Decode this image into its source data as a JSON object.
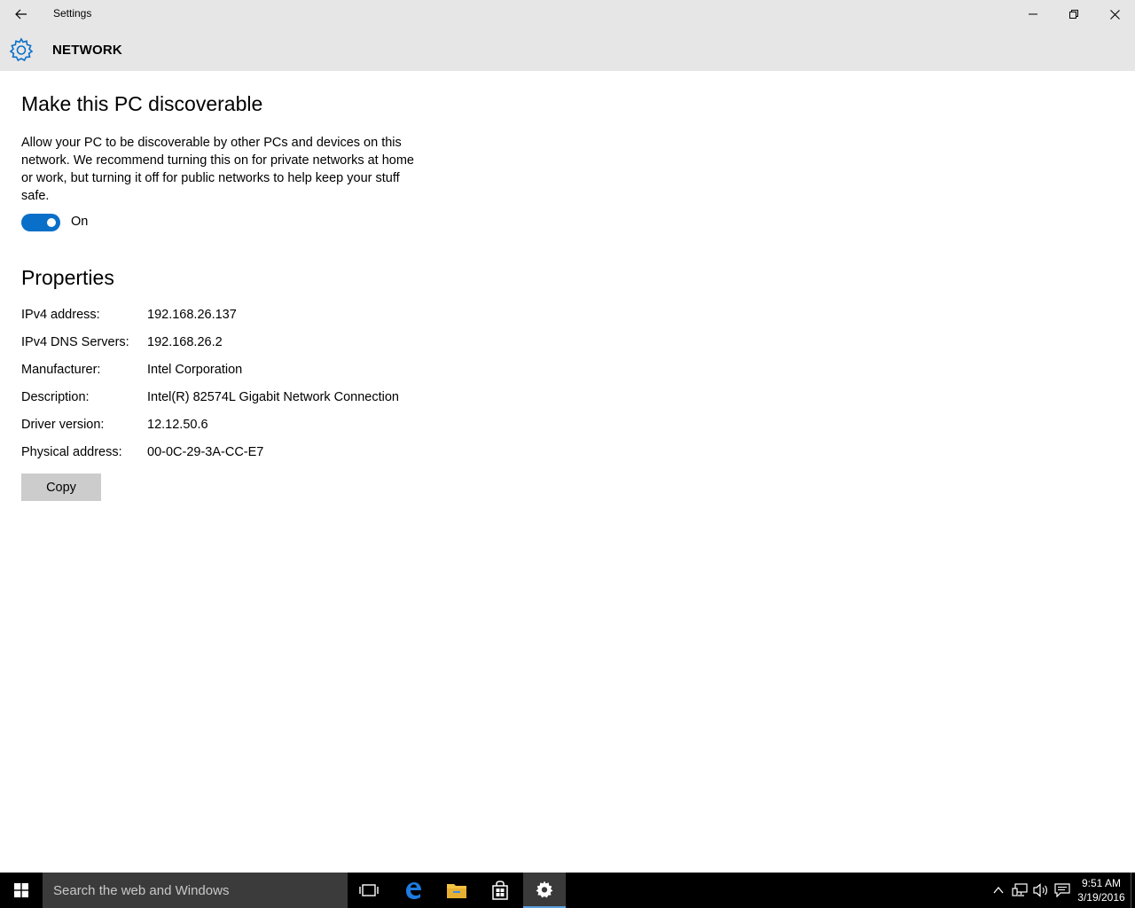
{
  "window": {
    "title": "Settings",
    "back_icon": "arrow-left-icon",
    "minimize_icon": "minimize-icon",
    "restore_icon": "restore-icon",
    "close_icon": "close-icon"
  },
  "header": {
    "icon": "gear-icon",
    "title": "NETWORK",
    "accent": "#0a6fc9"
  },
  "discoverable": {
    "heading": "Make this PC discoverable",
    "description": "Allow your PC to be discoverable by other PCs and devices on this network. We recommend turning this on for private networks at home or work, but turning it off for public networks to help keep your stuff safe.",
    "toggle_state": "On"
  },
  "properties": {
    "heading": "Properties",
    "rows": [
      {
        "label": "IPv4 address:",
        "value": "192.168.26.137"
      },
      {
        "label": "IPv4 DNS Servers:",
        "value": "192.168.26.2"
      },
      {
        "label": "Manufacturer:",
        "value": "Intel Corporation"
      },
      {
        "label": "Description:",
        "value": "Intel(R) 82574L Gigabit Network Connection"
      },
      {
        "label": "Driver version:",
        "value": "12.12.50.6"
      },
      {
        "label": "Physical address:",
        "value": "00-0C-29-3A-CC-E7"
      }
    ],
    "copy_label": "Copy"
  },
  "taskbar": {
    "search_placeholder": "Search the web and Windows",
    "apps": [
      "task-view-icon",
      "edge-icon",
      "file-explorer-icon",
      "store-icon",
      "settings-gear-icon"
    ],
    "active_app": "settings-gear-icon",
    "tray": [
      "chevron-up-icon",
      "network-icon",
      "volume-icon",
      "action-center-icon"
    ],
    "time": "9:51 AM",
    "date": "3/19/2016"
  }
}
